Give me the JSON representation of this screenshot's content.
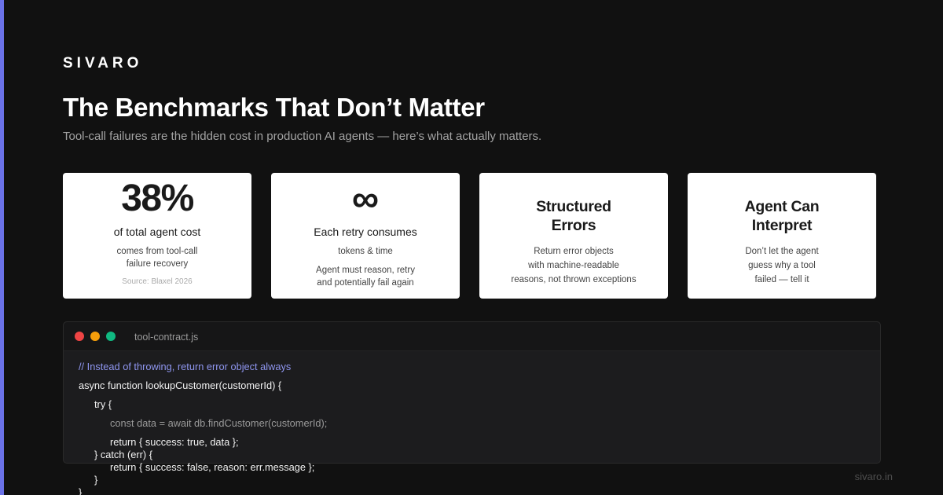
{
  "brand": "SIVARO",
  "title": "The Benchmarks That Don’t Matter",
  "subtitle": "Tool-call failures are the hidden cost in production AI agents — here’s what actually matters.",
  "cards": [
    {
      "big": "38%",
      "label": "of total agent cost",
      "desc_line1": "comes from tool-call",
      "desc_line2": "failure recovery",
      "source": "Source: Blaxel 2026"
    },
    {
      "big": "∞",
      "label": "Each retry consumes",
      "desc": "tokens & time",
      "desc2_line1": "Agent must reason, retry",
      "desc2_line2": "and potentially fail again"
    },
    {
      "head_line1": "Structured",
      "head_line2": "Errors",
      "desc_line1": "Return error objects",
      "desc_line2": "with machine-readable",
      "desc_line3": "reasons, not thrown exceptions"
    },
    {
      "head_line1": "Agent Can",
      "head_line2": "Interpret",
      "desc_line1": "Don’t let the agent",
      "desc_line2": "guess why a tool",
      "desc_line3": "failed — tell it"
    }
  ],
  "code": {
    "filename": "tool-contract.js",
    "lines": [
      "// Instead of throwing, return error object always",
      "async function lookupCustomer(customerId) {",
      "try {",
      "const data = await db.findCustomer(customerId);",
      "return { success: true, data };",
      "} catch (err) {",
      "return { success: false, reason: err.message };",
      "}",
      "}"
    ]
  },
  "footer_url": "sivaro.in",
  "colors": {
    "background": "#111111",
    "accent_bar": "#6b72e8",
    "comment": "#8f96f0",
    "dot_red": "#ef4444",
    "dot_yellow": "#f59e0b",
    "dot_green": "#10b981"
  }
}
